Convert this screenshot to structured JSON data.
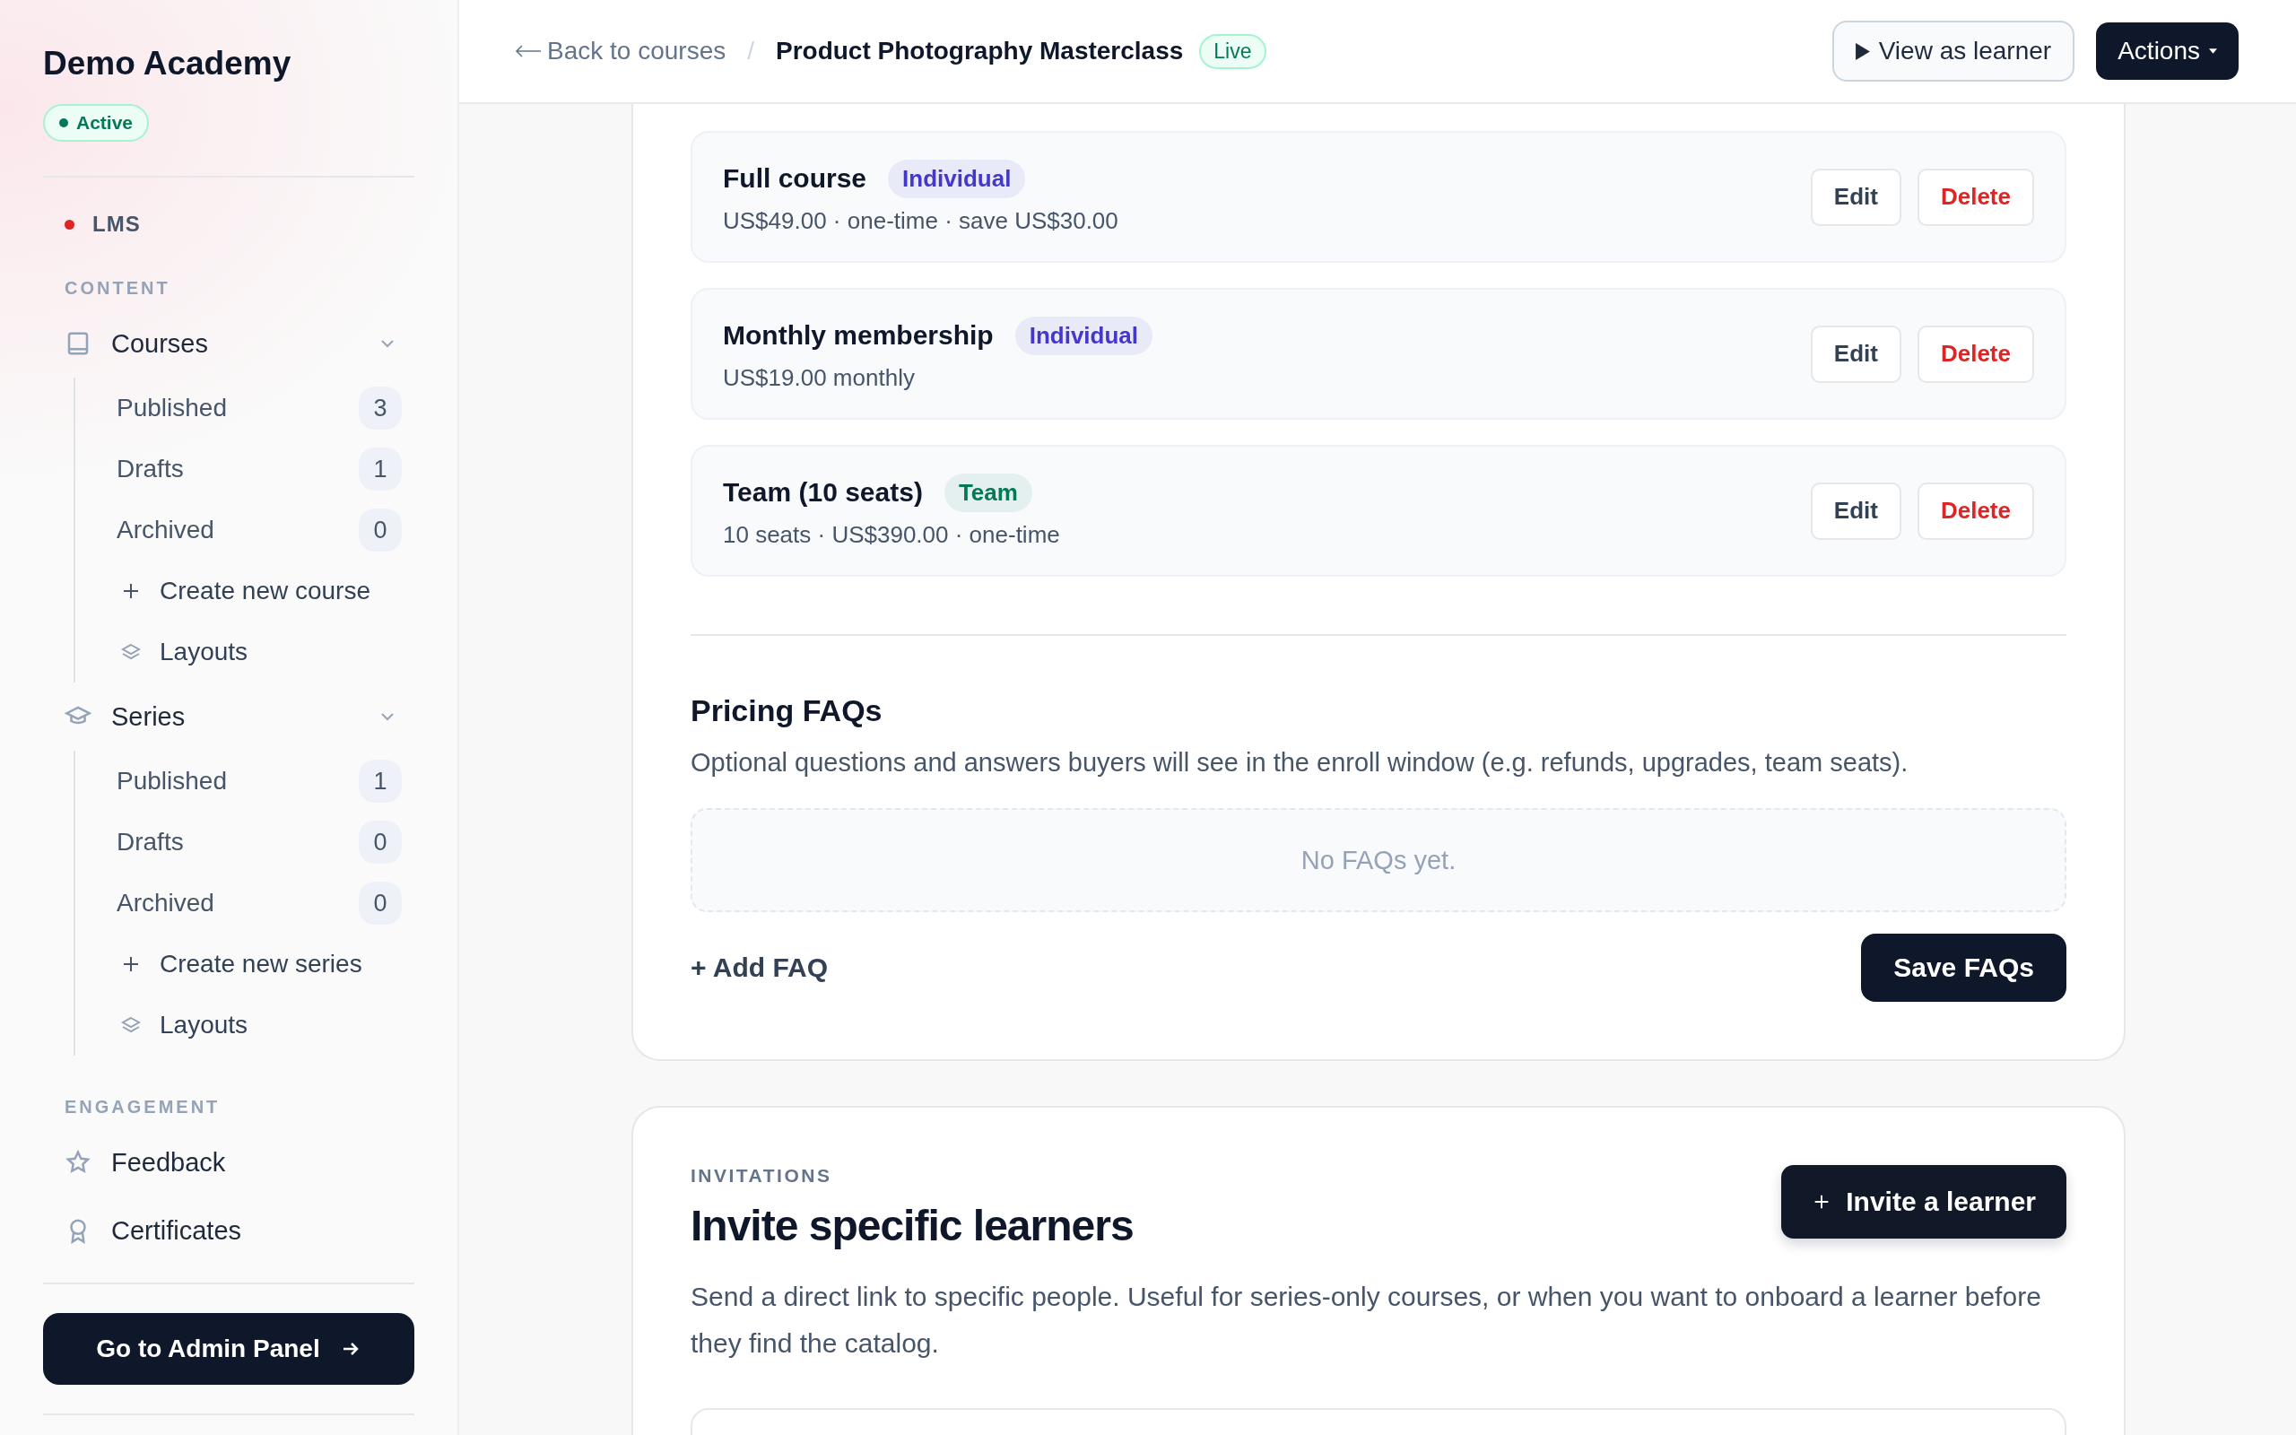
{
  "sidebar": {
    "brand": "Demo Academy",
    "status": {
      "label": "Active",
      "on": true
    },
    "app": {
      "label": "LMS",
      "color": "#dc2626"
    },
    "sections": [
      {
        "title": "CONTENT",
        "items": [
          {
            "label": "Courses",
            "expanded": true,
            "children": [
              {
                "kind": "filter",
                "label": "Published",
                "count": "3"
              },
              {
                "kind": "filter",
                "label": "Drafts",
                "count": "1"
              },
              {
                "kind": "filter",
                "label": "Archived",
                "count": "0"
              },
              {
                "kind": "create",
                "label": "Create new course"
              },
              {
                "kind": "layouts",
                "label": "Layouts"
              }
            ]
          },
          {
            "label": "Series",
            "expanded": true,
            "children": [
              {
                "kind": "filter",
                "label": "Published",
                "count": "1"
              },
              {
                "kind": "filter",
                "label": "Drafts",
                "count": "0"
              },
              {
                "kind": "filter",
                "label": "Archived",
                "count": "0"
              },
              {
                "kind": "create",
                "label": "Create new series"
              },
              {
                "kind": "layouts",
                "label": "Layouts"
              }
            ]
          }
        ]
      },
      {
        "title": "ENGAGEMENT",
        "items": [
          {
            "label": "Feedback"
          },
          {
            "label": "Certificates"
          }
        ]
      }
    ],
    "admin_button": "Go to Admin Panel"
  },
  "topbar": {
    "back": "Back to courses",
    "separator": "/",
    "title": "Product Photography Masterclass",
    "status": "Live",
    "view_button": "View as learner",
    "actions_button": "Actions"
  },
  "plans": [
    {
      "name": "Full course",
      "tag": {
        "label": "Individual",
        "color": "#4338ca"
      },
      "details": "US$49.00 · one-time · save US$30.00",
      "edit": "Edit",
      "delete": "Delete"
    },
    {
      "name": "Monthly membership",
      "tag": {
        "label": "Individual",
        "color": "#4338ca"
      },
      "details": "US$19.00 monthly",
      "edit": "Edit",
      "delete": "Delete"
    },
    {
      "name": "Team (10 seats)",
      "tag": {
        "label": "Team",
        "color": "#047857"
      },
      "details": "10 seats · US$390.00 · one-time",
      "edit": "Edit",
      "delete": "Delete"
    }
  ],
  "faqs": {
    "title": "Pricing FAQs",
    "description": "Optional questions and answers buyers will see in the enroll window (e.g. refunds, upgrades, team seats).",
    "empty": "No FAQs yet.",
    "add": "+ Add FAQ",
    "save": "Save FAQs"
  },
  "invitations": {
    "eyebrow": "INVITATIONS",
    "title": "Invite specific learners",
    "description": "Send a direct link to specific people. Useful for series-only courses, or when you want to onboard a learner before they find the catalog.",
    "button": "Invite a learner"
  }
}
